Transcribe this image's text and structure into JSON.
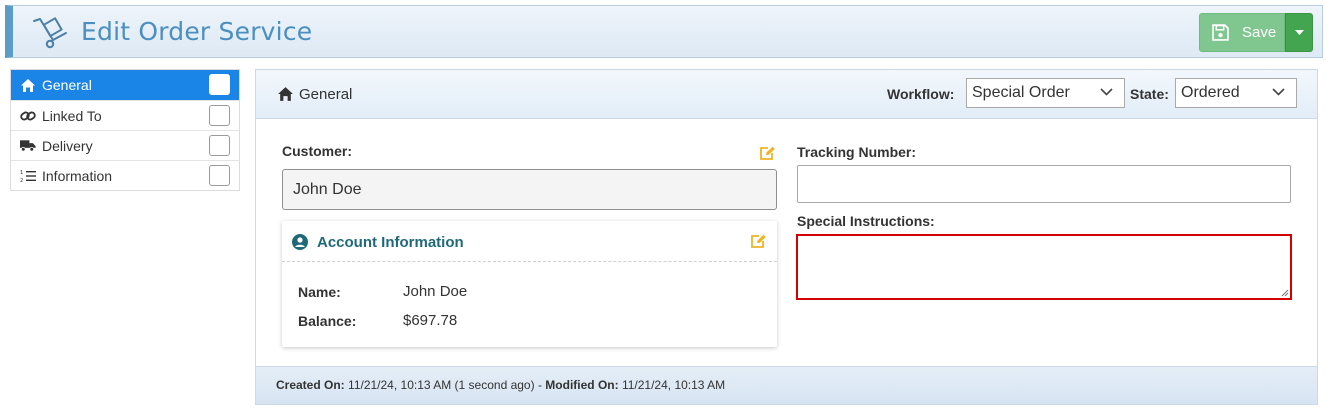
{
  "header": {
    "title": "Edit Order Service",
    "icon": "hand-truck-icon",
    "save_label": "Save",
    "accent": "#5b9cc9"
  },
  "sidebar": {
    "items": [
      {
        "label": "General",
        "icon": "home-icon",
        "active": true
      },
      {
        "label": "Linked To",
        "icon": "link-icon",
        "active": false
      },
      {
        "label": "Delivery",
        "icon": "truck-icon",
        "active": false
      },
      {
        "label": "Information",
        "icon": "list-ordered-icon",
        "active": false
      }
    ],
    "active_color": "#1b84e7"
  },
  "panel": {
    "title": "General",
    "workflow_label": "Workflow:",
    "workflow_value": "Special Order",
    "state_label": "State:",
    "state_value": "Ordered"
  },
  "customer": {
    "label": "Customer:",
    "value": "John Doe"
  },
  "account": {
    "title": "Account Information",
    "name_label": "Name:",
    "name_value": "John Doe",
    "balance_label": "Balance:",
    "balance_value": "$697.78"
  },
  "tracking": {
    "label": "Tracking Number:",
    "value": ""
  },
  "instructions": {
    "label": "Special Instructions:",
    "value": "",
    "error_color": "#d50000"
  },
  "footer": {
    "created_label": "Created On:",
    "created_value": "11/21/24, 10:13 AM (1 second ago)",
    "separator": " - ",
    "modified_label": "Modified On:",
    "modified_value": "11/21/24, 10:13 AM"
  }
}
